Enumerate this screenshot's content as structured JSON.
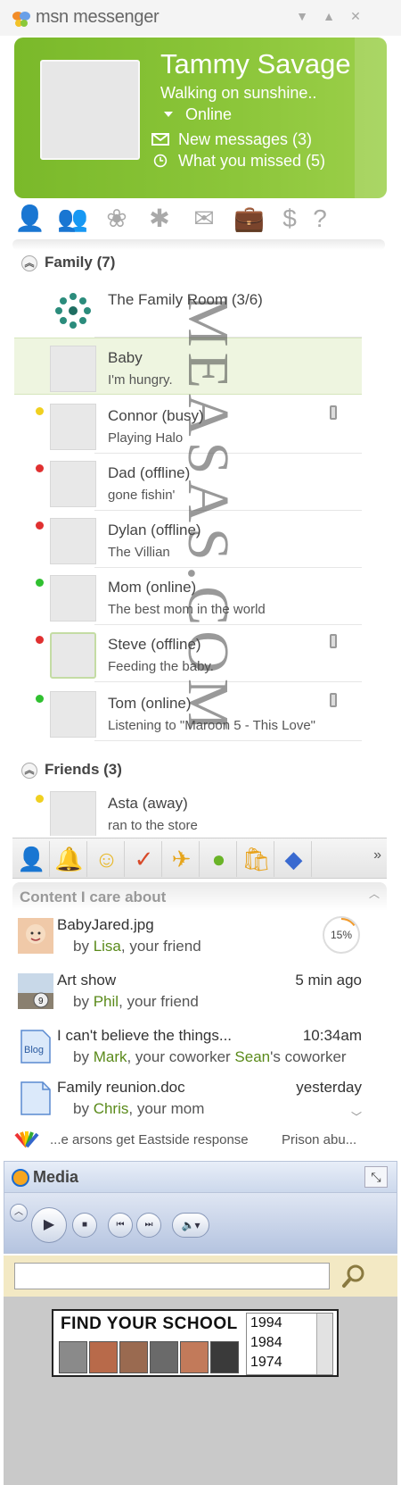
{
  "window": {
    "title": "msn messenger",
    "controls": [
      "minimize-dropdown",
      "maximize",
      "close"
    ]
  },
  "profile": {
    "name": "Tammy Savage",
    "personal_message": "Walking on sunshine..",
    "status": "Online",
    "notifications": [
      {
        "label": "New messages (3)",
        "icon": "mail-icon"
      },
      {
        "label": "What you missed (5)",
        "icon": "clock-icon"
      }
    ],
    "accent_color": "#7ab92a"
  },
  "toolbar": {
    "icons": [
      "contacts-icon",
      "groups-icon",
      "butterfly-icon",
      "spaces-icon",
      "mail-icon",
      "briefcase-icon",
      "money-icon",
      "help-icon"
    ],
    "icon_glyphs": [
      "👤",
      "👥",
      "❀",
      "✱",
      "✉",
      "💼",
      "$",
      "?"
    ]
  },
  "groups": [
    {
      "name": "Family (7)",
      "contacts": [
        {
          "name": "The Family Room (3/6)",
          "message": "",
          "status_color": "",
          "mobile": false,
          "type": "room"
        },
        {
          "name": "Baby",
          "message": "I'm hungry.",
          "status_color": "",
          "mobile": false,
          "selected": true
        },
        {
          "name": "Connor (busy)",
          "message": "Playing Halo",
          "status_color": "#f0d020",
          "mobile": true
        },
        {
          "name": "Dad (offline)",
          "message": "gone fishin'",
          "status_color": "#e03030",
          "mobile": false
        },
        {
          "name": "Dylan (offline)",
          "message": "The Villian",
          "status_color": "#e03030",
          "mobile": false
        },
        {
          "name": "Mom (online)",
          "message": "The best mom in the world",
          "status_color": "#30c030",
          "mobile": false
        },
        {
          "name": "Steve (offline)",
          "message": "Feeding the baby.",
          "status_color": "#e03030",
          "mobile": true
        },
        {
          "name": "Tom (online)",
          "message": "Listening to \"Maroon 5 - This Love\"",
          "status_color": "#30c030",
          "mobile": true
        }
      ]
    },
    {
      "name": "Friends (3)",
      "contacts": [
        {
          "name": "Asta (away)",
          "message": "ran to the store",
          "status_color": "#f0d020",
          "mobile": false
        }
      ]
    }
  ],
  "apps": {
    "icons": [
      "messenger-icon",
      "bell-icon",
      "smiley-icon",
      "msn-butterfly-icon",
      "plane-icon",
      "xbox-icon",
      "shopping-bag-icon",
      "nbc-icon"
    ],
    "glyphs": [
      "👤",
      "🔔",
      "☺",
      "✓",
      "✈",
      "●",
      "🛍",
      "◆"
    ],
    "more_label": "»"
  },
  "content": {
    "title": "Content I care about",
    "items": [
      {
        "title": "BabyJared.jpg",
        "by": "by",
        "who": "Lisa",
        "rel": ", your friend",
        "time": "",
        "progress_label": "15%",
        "progress": 15
      },
      {
        "title": "Art show",
        "by": "by",
        "who": "Phil",
        "rel": ", your friend",
        "time": "5 min ago",
        "badge": "9"
      },
      {
        "title": "I can't believe the things...",
        "by": "by",
        "who": "Mark",
        "rel": ", your coworker ",
        "who2": "Sean",
        "rel2": "'s coworker",
        "time": "10:34am",
        "thumb_label": "Blog"
      },
      {
        "title": "Family reunion.doc",
        "by": "by",
        "who": "Chris",
        "rel": ", your mom",
        "time": "yesterday"
      }
    ]
  },
  "news": {
    "item1": "...e arsons get Eastside response",
    "item2": "Prison abu..."
  },
  "media": {
    "title": "Media"
  },
  "search": {
    "value": "",
    "placeholder": ""
  },
  "ad": {
    "title": "FIND YOUR SCHOOL",
    "years": [
      "1994",
      "1984",
      "1974"
    ]
  },
  "watermark": "MEASAS.COM"
}
